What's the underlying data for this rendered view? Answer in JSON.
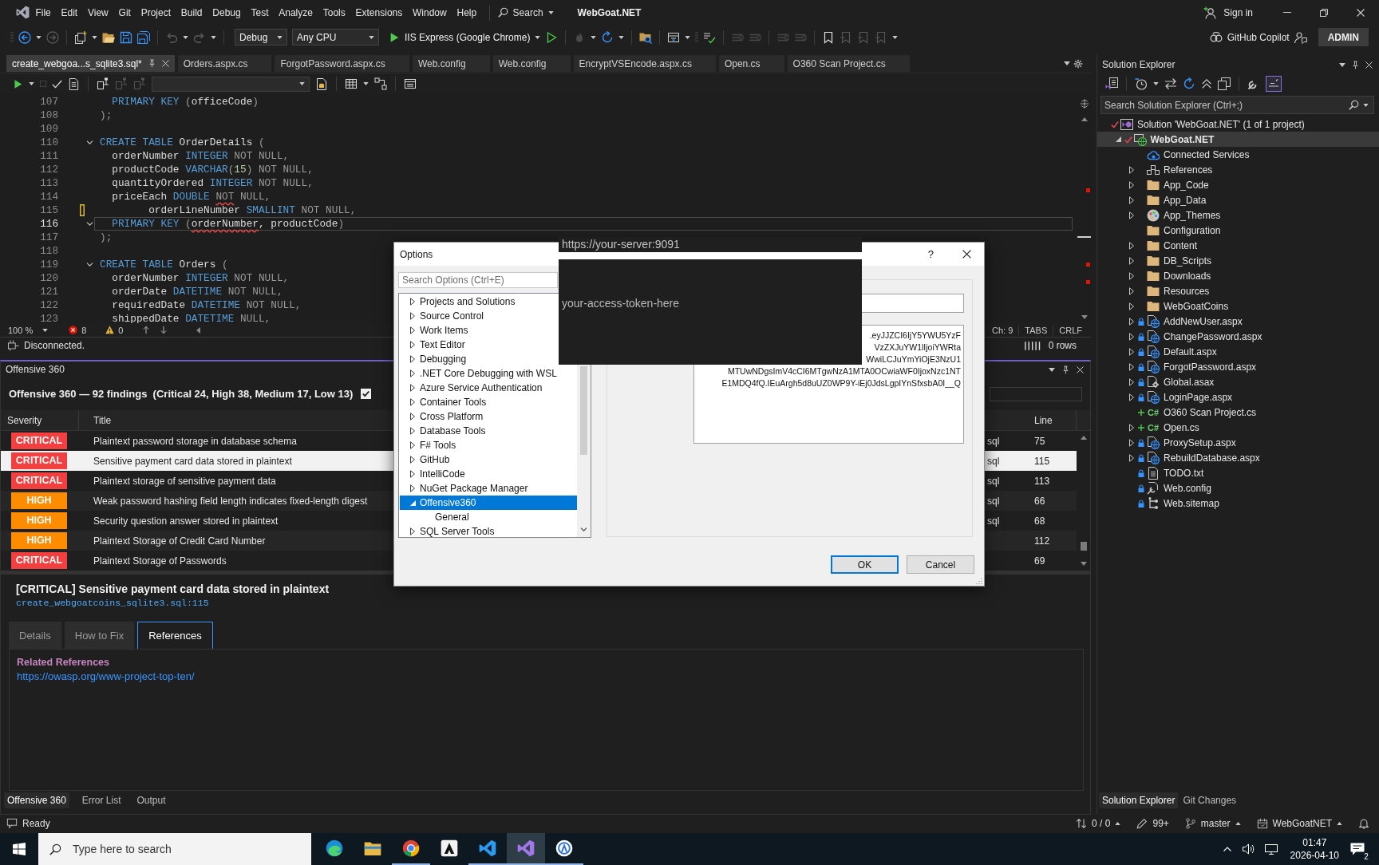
{
  "window": {
    "title": "WebGoat.NET",
    "search_label": "Search",
    "sign_in": "Sign in"
  },
  "menu": [
    "File",
    "Edit",
    "View",
    "Git",
    "Project",
    "Build",
    "Debug",
    "Test",
    "Analyze",
    "Tools",
    "Extensions",
    "Window",
    "Help"
  ],
  "toolbar": {
    "configuration": "Debug",
    "platform": "Any CPU",
    "start_target": "IIS Express (Google Chrome)",
    "copilot": "GitHub Copilot",
    "account": "ADMIN"
  },
  "document_tabs": [
    {
      "label": "create_webgoa...s_sqlite3.sql*",
      "selected": true
    },
    {
      "label": "Orders.aspx.cs",
      "selected": false
    },
    {
      "label": "ForgotPassword.aspx.cs",
      "selected": false
    },
    {
      "label": "Web.config",
      "selected": false
    },
    {
      "label": "Web.config",
      "selected": false
    },
    {
      "label": "EncryptVSEncode.aspx.cs",
      "selected": false
    },
    {
      "label": "Open.cs",
      "selected": false
    },
    {
      "label": "O360 Scan Project.cs",
      "selected": false
    }
  ],
  "editor": {
    "lines": [
      {
        "number": "107",
        "fold": false,
        "changed": false,
        "current": false,
        "segments": [
          {
            "text": "  PRIMARY KEY",
            "kind": "keyword",
            "error": false
          },
          {
            "text": " (",
            "kind": "muted",
            "error": false
          },
          {
            "text": "officeCode",
            "kind": "plain",
            "error": false
          },
          {
            "text": ")",
            "kind": "muted",
            "error": false
          }
        ]
      },
      {
        "number": "108",
        "fold": false,
        "changed": false,
        "current": false,
        "segments": [
          {
            "text": ");",
            "kind": "muted",
            "error": false
          }
        ]
      },
      {
        "number": "109",
        "fold": false,
        "changed": false,
        "current": false
      },
      {
        "number": "110",
        "fold": true,
        "changed": false,
        "current": false,
        "segments": [
          {
            "text": "CREATE TABLE",
            "kind": "keyword",
            "error": false
          },
          {
            "text": " OrderDetails ",
            "kind": "plain",
            "error": false
          },
          {
            "text": "(",
            "kind": "muted",
            "error": false
          }
        ]
      },
      {
        "number": "111",
        "fold": false,
        "changed": false,
        "current": false,
        "segments": [
          {
            "text": "  orderNumber ",
            "kind": "plain",
            "error": false
          },
          {
            "text": "INTEGER",
            "kind": "keyword",
            "error": false
          },
          {
            "text": " NOT NULL,",
            "kind": "muted",
            "error": false
          }
        ]
      },
      {
        "number": "112",
        "fold": false,
        "changed": false,
        "current": false,
        "segments": [
          {
            "text": "  productCode ",
            "kind": "plain",
            "error": false
          },
          {
            "text": "VARCHAR",
            "kind": "keyword",
            "error": false
          },
          {
            "text": "(",
            "kind": "muted",
            "error": false
          },
          {
            "text": "15",
            "kind": "number",
            "error": false
          },
          {
            "text": ")",
            "kind": "muted",
            "error": false
          },
          {
            "text": " NOT NULL,",
            "kind": "muted",
            "error": false
          }
        ]
      },
      {
        "number": "113",
        "fold": false,
        "changed": false,
        "current": false,
        "segments": [
          {
            "text": "  quantityOrdered ",
            "kind": "plain",
            "error": false
          },
          {
            "text": "INTEGER",
            "kind": "keyword",
            "error": false
          },
          {
            "text": " NOT NULL,",
            "kind": "muted",
            "error": false
          }
        ]
      },
      {
        "number": "114",
        "fold": false,
        "changed": false,
        "current": false,
        "segments": [
          {
            "text": "  priceEach ",
            "kind": "plain",
            "error": false
          },
          {
            "text": "DOUBLE ",
            "kind": "keyword",
            "error": false
          },
          {
            "text": "NOT",
            "kind": "muted",
            "error": true
          },
          {
            "text": " NULL,",
            "kind": "muted",
            "error": false
          }
        ]
      },
      {
        "number": "115",
        "fold": false,
        "changed": true,
        "current": false,
        "segments": [
          {
            "text": "        orderLineNumber ",
            "kind": "plain",
            "error": false
          },
          {
            "text": "SMALLINT",
            "kind": "keyword",
            "error": false
          },
          {
            "text": " NOT NULL,",
            "kind": "muted",
            "error": false
          }
        ]
      },
      {
        "number": "116",
        "fold": true,
        "changed": false,
        "current": true,
        "segments": [
          {
            "text": "  PRIMARY KEY",
            "kind": "keyword",
            "error": false
          },
          {
            "text": " (",
            "kind": "muted",
            "error": false
          },
          {
            "text": "orderNumber",
            "kind": "plain",
            "error": true
          },
          {
            "text": ", productCode",
            "kind": "plain",
            "error": false
          },
          {
            "text": ")",
            "kind": "muted",
            "error": false
          }
        ]
      },
      {
        "number": "117",
        "fold": false,
        "changed": false,
        "current": false,
        "segments": [
          {
            "text": ");",
            "kind": "muted",
            "error": false
          }
        ]
      },
      {
        "number": "118",
        "fold": false,
        "changed": false,
        "current": false
      },
      {
        "number": "119",
        "fold": true,
        "changed": false,
        "current": false,
        "segments": [
          {
            "text": "CREATE TABLE",
            "kind": "keyword",
            "error": false
          },
          {
            "text": " Orders ",
            "kind": "plain",
            "error": false
          },
          {
            "text": "(",
            "kind": "muted",
            "error": false
          }
        ]
      },
      {
        "number": "120",
        "fold": false,
        "changed": false,
        "current": false,
        "segments": [
          {
            "text": "  orderNumber ",
            "kind": "plain",
            "error": false
          },
          {
            "text": "INTEGER",
            "kind": "keyword",
            "error": false
          },
          {
            "text": " NOT NULL,",
            "kind": "muted",
            "error": false
          }
        ]
      },
      {
        "number": "121",
        "fold": false,
        "changed": false,
        "current": false,
        "segments": [
          {
            "text": "  orderDate ",
            "kind": "plain",
            "error": false
          },
          {
            "text": "DATETIME",
            "kind": "keyword",
            "error": false
          },
          {
            "text": " NOT NULL,",
            "kind": "muted",
            "error": false
          }
        ]
      },
      {
        "number": "122",
        "fold": false,
        "changed": false,
        "current": false,
        "segments": [
          {
            "text": "  requiredDate ",
            "kind": "plain",
            "error": false
          },
          {
            "text": "DATETIME",
            "kind": "keyword",
            "error": false
          },
          {
            "text": " NOT NULL,",
            "kind": "muted",
            "error": false
          }
        ]
      },
      {
        "number": "123",
        "fold": false,
        "changed": false,
        "current": false,
        "segments": [
          {
            "text": "  shippedDate ",
            "kind": "plain",
            "error": false
          },
          {
            "text": "DATETIME",
            "kind": "keyword",
            "error": false
          },
          {
            "text": " NULL,",
            "kind": "muted",
            "error": false
          }
        ]
      }
    ],
    "zoom": "100 %",
    "errors": "8",
    "warnings": "0",
    "column": "Ch: 9",
    "indentation": "TABS",
    "line_ending": "CRLF"
  },
  "connection": {
    "status": "Disconnected.",
    "rows": "0 rows"
  },
  "findings_panel": {
    "title": "Offensive 360",
    "summary": "Offensive 360 — 92 findings  (Critical 24, High 38, Medium 17, Low 13)",
    "checkbox": {
      "checked": true
    },
    "columns": [
      "Severity",
      "Title",
      "Line"
    ],
    "rows": [
      {
        "severity": "CRITICAL",
        "color": "#f23f3f",
        "title": "Plaintext password storage in database schema",
        "column_3": "sql",
        "line": "75",
        "selected": false
      },
      {
        "severity": "CRITICAL",
        "color": "#f23f3f",
        "title": "Sensitive payment card data stored in plaintext",
        "column_3": "sql",
        "line": "115",
        "selected": true
      },
      {
        "severity": "CRITICAL",
        "color": "#f23f3f",
        "title": "Plaintext storage of sensitive payment data",
        "column_3": "sql",
        "line": "113",
        "selected": false
      },
      {
        "severity": "HIGH",
        "color": "#ff8c00",
        "title": "Weak password hashing field length indicates fixed-length digest",
        "column_3": "sql",
        "line": "66",
        "selected": false
      },
      {
        "severity": "HIGH",
        "color": "#ff8c00",
        "title": "Security question answer stored in plaintext",
        "column_3": "sql",
        "line": "68",
        "selected": false
      },
      {
        "severity": "HIGH",
        "color": "#ff8c00",
        "title": "Plaintext Storage of Credit Card Number",
        "line": "112",
        "selected": false
      },
      {
        "severity": "CRITICAL",
        "color": "#f23f3f",
        "title": "Plaintext Storage of Passwords",
        "line": "69",
        "selected": false
      }
    ]
  },
  "detail": {
    "title": "[CRITICAL] Sensitive payment card data stored in plaintext",
    "location": "create_webgoatcoins_sqlite3.sql:115",
    "tabs": [
      {
        "label": "Details",
        "selected": false
      },
      {
        "label": "How to Fix",
        "selected": false
      },
      {
        "label": "References",
        "selected": true
      }
    ],
    "section_heading": "Related References",
    "link": "https://owasp.org/www-project-top-ten/"
  },
  "panel_tabs": [
    {
      "label": "Offensive 360",
      "selected": true
    },
    {
      "label": "Error List",
      "selected": false
    },
    {
      "label": "Output",
      "selected": false
    }
  ],
  "options_dialog": {
    "title": "Options",
    "help": "?",
    "search_placeholder": "Search Options (Ctrl+E)",
    "tree": [
      {
        "label": "Projects and Solutions",
        "expanded": false,
        "selected": false
      },
      {
        "label": "Source Control",
        "expanded": false,
        "selected": false
      },
      {
        "label": "Work Items",
        "expanded": false,
        "selected": false
      },
      {
        "label": "Text Editor",
        "expanded": false,
        "selected": false
      },
      {
        "label": "Debugging",
        "expanded": false,
        "selected": false
      },
      {
        "label": ".NET Core Debugging with WSL",
        "expanded": false,
        "selected": false
      },
      {
        "label": "Azure Service Authentication",
        "expanded": false,
        "selected": false
      },
      {
        "label": "Container Tools",
        "expanded": false,
        "selected": false
      },
      {
        "label": "Cross Platform",
        "expanded": false,
        "selected": false
      },
      {
        "label": "Database Tools",
        "expanded": false,
        "selected": false
      },
      {
        "label": "F# Tools",
        "expanded": false,
        "selected": false
      },
      {
        "label": "GitHub",
        "expanded": false,
        "selected": false
      },
      {
        "label": "IntelliCode",
        "expanded": false,
        "selected": false
      },
      {
        "label": "NuGet Package Manager",
        "expanded": false,
        "selected": false
      },
      {
        "label": "Offensive360",
        "expanded": true,
        "selected": true,
        "children": [
          {
            "label": "General",
            "selected": false
          }
        ]
      },
      {
        "label": "SQL Server Tools",
        "expanded": false,
        "selected": false
      }
    ],
    "token_lines": [
      ".eyJJZCI6IjY5YWU5YzF",
      "VzZXJuYW1lIjoiYWRta",
      "WwiLCJuYmYiOjE3NzU1",
      "MTUwNDgsImV4cCI6MTgwNzA1MTA0OCwiaWF0IjoxNzc1NT",
      "E1MDQ4fQ.IEuArgh5d8uUZ0WP9Y-iEj0JdsLgpIYnSfxsbA0I__Q"
    ],
    "buttons": [
      {
        "label": "OK",
        "default": true
      },
      {
        "label": "Cancel",
        "default": false
      }
    ]
  },
  "redactions": [
    {
      "kind": "strip",
      "text": "https://your-server:9091"
    },
    {
      "kind": "block",
      "text": "your-access-token-here"
    }
  ],
  "solution_explorer": {
    "title": "Solution Explorer",
    "search_placeholder": "Search Solution Explorer (Ctrl+;)",
    "tree": [
      {
        "label": "Solution 'WebGoat.NET' (1 of 1 project)",
        "kind": "solution",
        "modified": true,
        "checked_in": false,
        "added": false,
        "selected": false,
        "children": [
          {
            "label": "WebGoat.NET",
            "kind": "project",
            "modified": true,
            "checked_in": false,
            "added": false,
            "expanded": true,
            "selected": true,
            "children": [
              {
                "label": "Connected Services",
                "kind": "services",
                "modified": false,
                "checked_in": false,
                "added": false,
                "selected": false
              },
              {
                "label": "References",
                "kind": "references",
                "modified": false,
                "checked_in": false,
                "added": false,
                "expanded": false,
                "selected": false
              },
              {
                "label": "App_Code",
                "kind": "folder",
                "modified": false,
                "checked_in": false,
                "added": false,
                "expanded": false,
                "selected": false
              },
              {
                "label": "App_Data",
                "kind": "folder",
                "modified": false,
                "checked_in": false,
                "added": false,
                "expanded": false,
                "selected": false
              },
              {
                "label": "App_Themes",
                "kind": "themes",
                "modified": false,
                "checked_in": false,
                "added": false,
                "expanded": false,
                "selected": false
              },
              {
                "label": "Configuration",
                "kind": "folder",
                "modified": false,
                "checked_in": false,
                "added": false,
                "selected": false
              },
              {
                "label": "Content",
                "kind": "folder",
                "modified": false,
                "checked_in": false,
                "added": false,
                "expanded": false,
                "selected": false
              },
              {
                "label": "DB_Scripts",
                "kind": "folder",
                "modified": false,
                "checked_in": false,
                "added": false,
                "expanded": false,
                "selected": false
              },
              {
                "label": "Downloads",
                "kind": "folder",
                "modified": false,
                "checked_in": false,
                "added": false,
                "expanded": false,
                "selected": false
              },
              {
                "label": "Resources",
                "kind": "folder",
                "modified": false,
                "checked_in": false,
                "added": false,
                "expanded": false,
                "selected": false
              },
              {
                "label": "WebGoatCoins",
                "kind": "folder",
                "modified": false,
                "checked_in": false,
                "added": false,
                "expanded": false,
                "selected": false
              },
              {
                "label": "AddNewUser.aspx",
                "kind": "page",
                "modified": false,
                "checked_in": true,
                "added": false,
                "expanded": false,
                "selected": false
              },
              {
                "label": "ChangePassword.aspx",
                "kind": "page",
                "modified": false,
                "checked_in": true,
                "added": false,
                "expanded": false,
                "selected": false
              },
              {
                "label": "Default.aspx",
                "kind": "page",
                "modified": false,
                "checked_in": true,
                "added": false,
                "expanded": false,
                "selected": false
              },
              {
                "label": "ForgotPassword.aspx",
                "kind": "page",
                "modified": false,
                "checked_in": true,
                "added": false,
                "expanded": false,
                "selected": false
              },
              {
                "label": "Global.asax",
                "kind": "global",
                "modified": false,
                "checked_in": true,
                "added": false,
                "expanded": false,
                "selected": false
              },
              {
                "label": "LoginPage.aspx",
                "kind": "page",
                "modified": false,
                "checked_in": true,
                "added": false,
                "expanded": false,
                "selected": false
              },
              {
                "label": "O360 Scan Project.cs",
                "kind": "code",
                "glyph": "C#",
                "modified": false,
                "checked_in": false,
                "added": true,
                "selected": false
              },
              {
                "label": "Open.cs",
                "kind": "code",
                "glyph": "C#",
                "modified": false,
                "checked_in": false,
                "added": true,
                "expanded": false,
                "selected": false
              },
              {
                "label": "ProxySetup.aspx",
                "kind": "page",
                "modified": false,
                "checked_in": true,
                "added": false,
                "expanded": false,
                "selected": false
              },
              {
                "label": "RebuildDatabase.aspx",
                "kind": "page",
                "modified": false,
                "checked_in": true,
                "added": false,
                "expanded": false,
                "selected": false
              },
              {
                "label": "TODO.txt",
                "kind": "text",
                "modified": false,
                "checked_in": true,
                "added": false,
                "selected": false
              },
              {
                "label": "Web.config",
                "kind": "config",
                "modified": false,
                "checked_in": true,
                "added": false,
                "selected": false
              },
              {
                "label": "Web.sitemap",
                "kind": "sitemap",
                "modified": false,
                "checked_in": true,
                "added": false,
                "selected": false
              }
            ]
          }
        ]
      }
    ],
    "tabs": [
      {
        "label": "Solution Explorer",
        "selected": true
      },
      {
        "label": "Git Changes",
        "selected": false
      }
    ]
  },
  "status_bar": {
    "message": "Ready",
    "changes": "0 / 0",
    "edits": "99+",
    "branch": "master",
    "repository": "WebGoatNET"
  },
  "taskbar": {
    "search_placeholder": "Type here to search",
    "apps": [
      {
        "kind": "swirl",
        "selected": false,
        "running": false
      },
      {
        "kind": "folder",
        "selected": false,
        "running": false
      },
      {
        "kind": "sphere",
        "selected": false,
        "running": true
      },
      {
        "kind": "tile",
        "selected": false,
        "running": false
      },
      {
        "kind": "ribbon",
        "selected": false,
        "running": true
      },
      {
        "kind": "ribbon-alt",
        "selected": true,
        "running": true
      },
      {
        "kind": "disc",
        "selected": false,
        "running": true
      }
    ],
    "time": "01:47",
    "date": "2026-04-10",
    "notifications": "2"
  }
}
